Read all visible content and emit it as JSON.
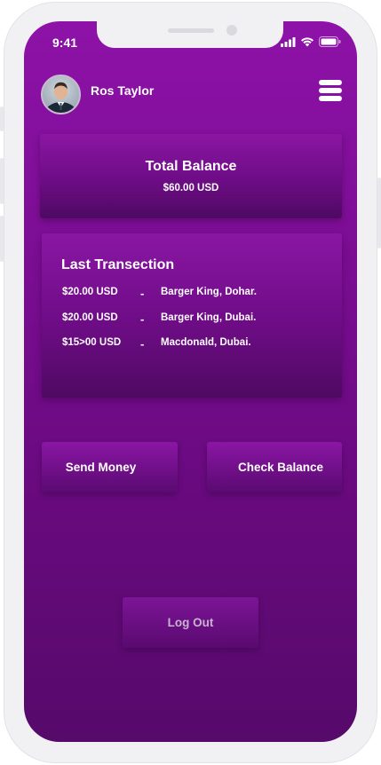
{
  "status_bar": {
    "time": "9:41"
  },
  "header": {
    "user_name": "Ros Taylor",
    "avatar_icon": "user-avatar",
    "menu_icon": "hamburger-menu-icon"
  },
  "balance": {
    "title": "Total Balance",
    "amount": "$60.00 USD"
  },
  "transactions": {
    "title": "Last Transection",
    "items": [
      {
        "amount": "$20.00 USD",
        "separator": "-",
        "place": "Barger King, Dohar."
      },
      {
        "amount": "$20.00 USD",
        "separator": "-",
        "place": "Barger King, Dubai."
      },
      {
        "amount": "$15>00 USD",
        "separator": "-",
        "place": "Macdonald, Dubai."
      }
    ]
  },
  "actions": {
    "send_money": "Send Money",
    "check_balance": "Check Balance",
    "logout": "Log Out"
  },
  "colors": {
    "primary_purple": "#8e12a8",
    "dark_purple": "#560a6a",
    "device_frame": "#f1f1f3"
  }
}
